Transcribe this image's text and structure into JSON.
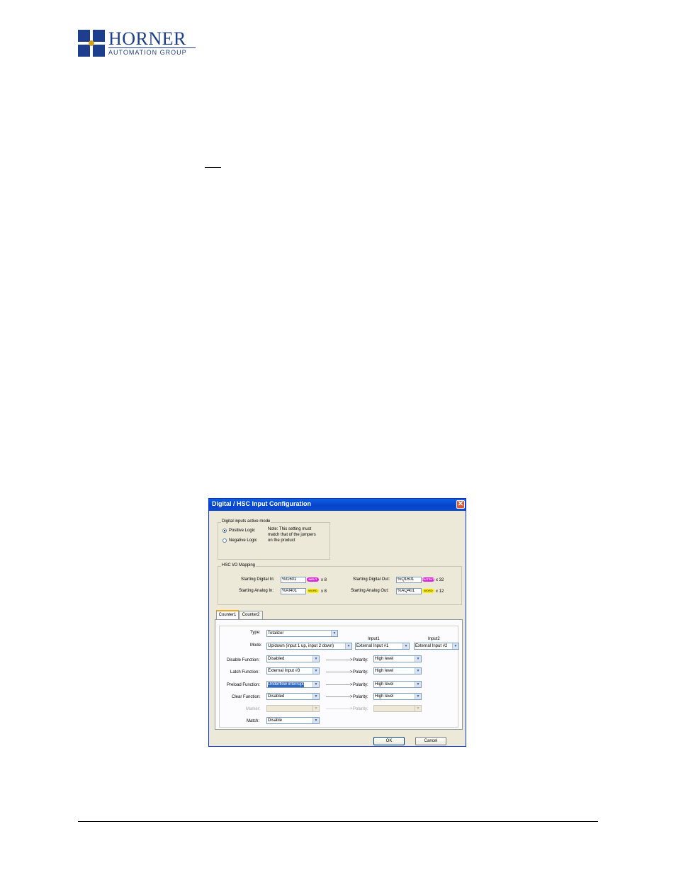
{
  "header": {
    "brand_name": "HORNER",
    "brand_sub": "AUTOMATION GROUP"
  },
  "dialog": {
    "title": "Digital / HSC Input Configuration",
    "close_glyph": "✕",
    "active_mode": {
      "legend": "Digital inputs active mode",
      "positive": "Positive Logic",
      "negative": "Negative Logic",
      "note": [
        "Note: This setting must",
        "match that of the jumpers",
        "on the product"
      ]
    },
    "mapping": {
      "legend": "HSC I/O Mapping",
      "digital_in_label": "Starting Digital In:",
      "digital_in": "%I1601",
      "digital_in_tag": "INPUT",
      "digital_in_count": "x 8",
      "analog_in_label": "Starting Analog In:",
      "analog_in": "%AI401",
      "analog_in_tag": "WORD",
      "analog_in_count": "x 8",
      "digital_out_label": "Starting Digital Out:",
      "digital_out": "%Q1601",
      "digital_out_tag": "OUTPUT",
      "digital_out_count": "x 32",
      "analog_out_label": "Starting Analog Out:",
      "analog_out": "%AQ401",
      "analog_out_tag": "WORD",
      "analog_out_count": "x 12"
    },
    "tabs": [
      "Counter1",
      "Counter2"
    ],
    "counter": {
      "type_label": "Type:",
      "type_value": "Totalizer",
      "input1_header": "Input1",
      "input2_header": "Input2",
      "mode_label": "Mode:",
      "mode_value": "Up/down (input 1 up, input 2 down)",
      "mode_input1": "External Input #1",
      "mode_input2": "External Input #2",
      "arrow": "----------------->",
      "polarity_label": "Polarity:",
      "disable_label": "Disable Function:",
      "disable_value": "Disabled",
      "disable_polarity": "High level",
      "latch_label": "Latch Function:",
      "latch_value": "External Input #3",
      "latch_polarity": "High level",
      "preload_label": "Preload Function:",
      "preload_value": "Underflow interrupt",
      "preload_polarity": "High level",
      "clear_label": "Clear Function:",
      "clear_value": "Disabled",
      "clear_polarity": "High level",
      "marker_label": "Marker:",
      "marker_value": "",
      "marker_polarity": "",
      "match_label": "Match:",
      "match_value": "Disable"
    },
    "ok_label": "OK",
    "cancel_label": "Cancel"
  }
}
